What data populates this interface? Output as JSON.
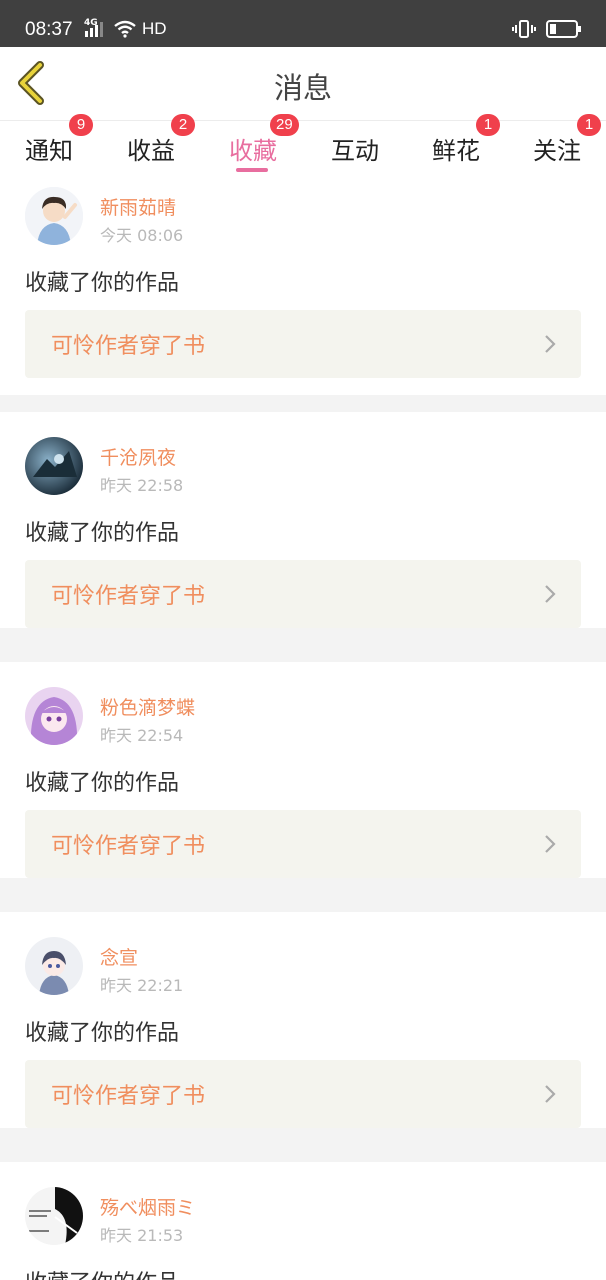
{
  "status_bar": {
    "time": "08:37",
    "network": "4G",
    "hd_label": "HD"
  },
  "header": {
    "title": "消息",
    "back_icon": "chevron-left-icon"
  },
  "tabs": [
    {
      "label": "通知",
      "badge": "9"
    },
    {
      "label": "收益",
      "badge": "2"
    },
    {
      "label": "收藏",
      "badge": "29",
      "active": true
    },
    {
      "label": "互动",
      "badge": ""
    },
    {
      "label": "鲜花",
      "badge": "1"
    },
    {
      "label": "关注",
      "badge": "1"
    }
  ],
  "colors": {
    "accent": "#e86e9f",
    "badge": "#f0404c",
    "username": "#f08e5e",
    "work_bg": "#f4f4ee"
  },
  "messages": [
    {
      "username": "新雨茹晴",
      "time": "今天 08:06",
      "action": "收藏了你的作品",
      "work": "可怜作者穿了书"
    },
    {
      "username": "千沧夙夜",
      "time": "昨天 22:58",
      "action": "收藏了你的作品",
      "work": "可怜作者穿了书"
    },
    {
      "username": "粉色滴梦蝶",
      "time": "昨天 22:54",
      "action": "收藏了你的作品",
      "work": "可怜作者穿了书"
    },
    {
      "username": "念宣",
      "time": "昨天 22:21",
      "action": "收藏了你的作品",
      "work": "可怜作者穿了书"
    },
    {
      "username": "殇べ烟雨ミ",
      "time": "昨天 21:53",
      "action": "收藏了你的作品",
      "work": ""
    }
  ]
}
